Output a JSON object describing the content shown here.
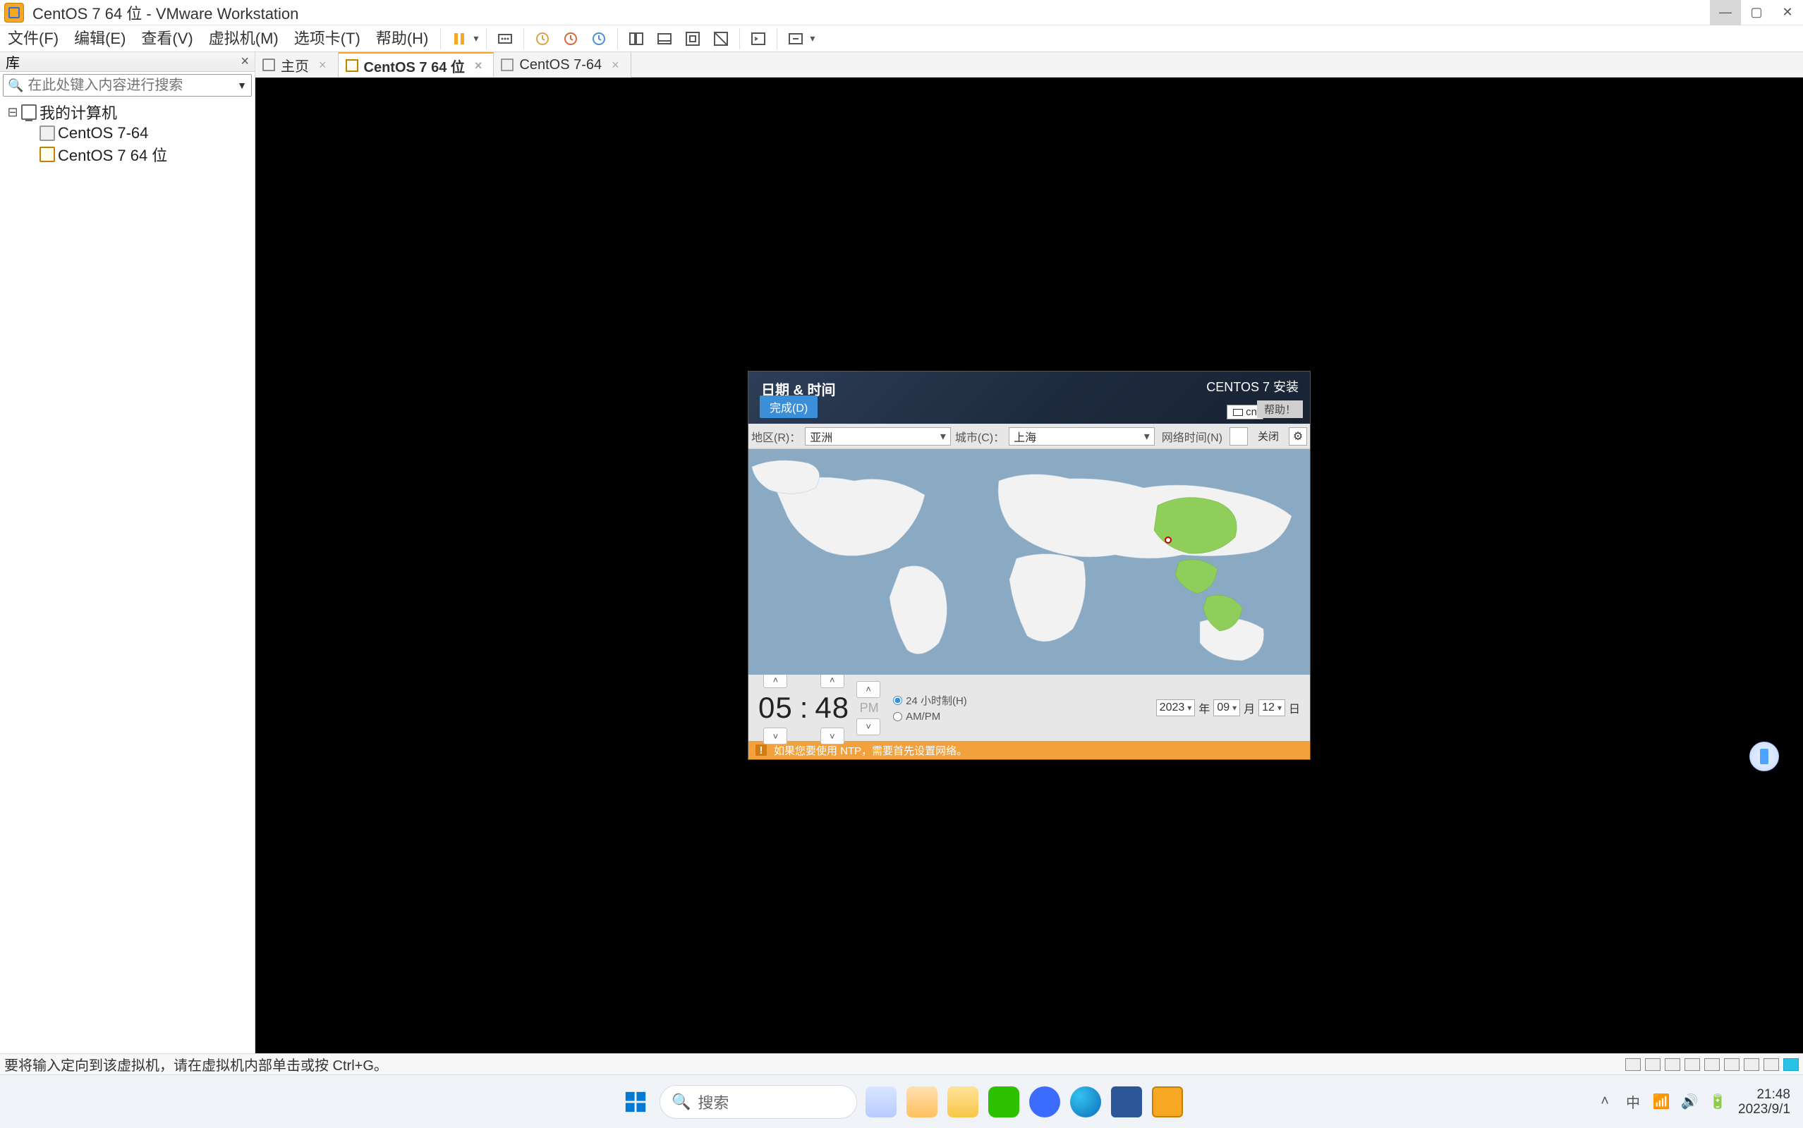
{
  "window": {
    "title": "CentOS 7 64 位 - VMware Workstation"
  },
  "menubar": {
    "items": [
      "文件(F)",
      "编辑(E)",
      "查看(V)",
      "虚拟机(M)",
      "选项卡(T)",
      "帮助(H)"
    ]
  },
  "sidebar": {
    "header": "库",
    "search_placeholder": "在此处键入内容进行搜索",
    "root": "我的计算机",
    "vms": [
      "CentOS 7-64",
      "CentOS 7 64 位"
    ]
  },
  "tabs": [
    {
      "label": "主页",
      "kind": "home",
      "active": false
    },
    {
      "label": "CentOS 7 64 位",
      "kind": "vm-on",
      "active": true
    },
    {
      "label": "CentOS 7-64",
      "kind": "vm",
      "active": false
    }
  ],
  "installer": {
    "title": "日期 & 时间",
    "subtitle": "CENTOS 7 安装",
    "done": "完成(D)",
    "help": "帮助！",
    "kb": "cn",
    "region_label": "地区(R)：",
    "region_value": "亚洲",
    "city_label": "城市(C)：",
    "city_value": "上海",
    "ntp_label": "网络时间(N)",
    "ntp_state": "关闭",
    "hour": "05",
    "minute": "48",
    "ampm": "PM",
    "fmt24": "24 小时制(H)",
    "fmtampm": "AM/PM",
    "year": "2023",
    "year_u": "年",
    "month": "09",
    "month_u": "月",
    "day": "12",
    "day_u": "日",
    "warning": "如果您要使用 NTP，需要首先设置网络。"
  },
  "statusbar": {
    "hint": "要将输入定向到该虚拟机，请在虚拟机内部单击或按 Ctrl+G。"
  },
  "taskbar": {
    "search": "搜索",
    "ime": "中",
    "time": "21:48",
    "date": "2023/9/1"
  }
}
